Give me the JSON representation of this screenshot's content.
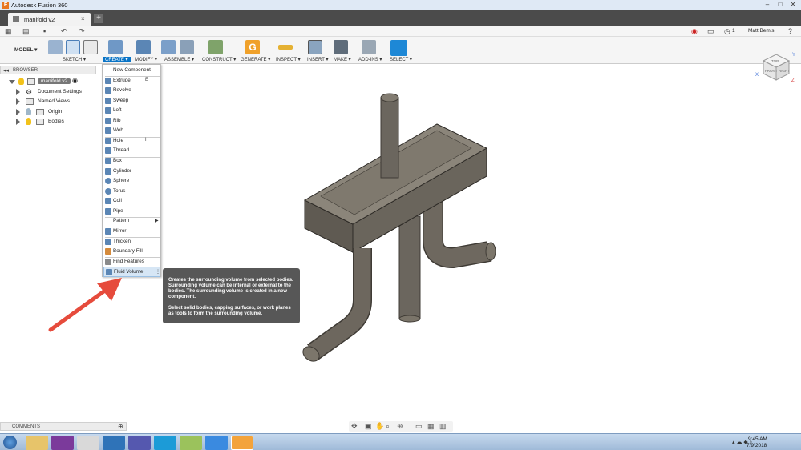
{
  "window": {
    "title": "Autodesk Fusion 360",
    "app_logo": "F"
  },
  "tabs": {
    "doc_title": "manifold v2",
    "close": "×",
    "new_tab": "+"
  },
  "quick_access": {
    "notification_count": "1",
    "user": "Matt Bemis"
  },
  "toolbar": {
    "workspace": "MODEL ▾",
    "groups": [
      "SKETCH ▾",
      "CREATE ▾",
      "MODIFY ▾",
      "ASSEMBLE ▾",
      "CONSTRUCT ▾",
      "GENERATE ▾",
      "INSPECT ▾",
      "INSERT ▾",
      "MAKE ▾",
      "ADD-INS ▾",
      "SELECT ▾"
    ],
    "active_group": "CREATE"
  },
  "browser": {
    "header": "BROWSER",
    "root": "manifold v2",
    "items": [
      "Document Settings",
      "Named Views",
      "Origin",
      "Bodies"
    ]
  },
  "create_menu": {
    "items": [
      {
        "label": "New Component",
        "key": ""
      },
      {
        "label": "Extrude",
        "key": "E"
      },
      {
        "label": "Revolve",
        "key": ""
      },
      {
        "label": "Sweep",
        "key": ""
      },
      {
        "label": "Loft",
        "key": ""
      },
      {
        "label": "Rib",
        "key": ""
      },
      {
        "label": "Web",
        "key": ""
      },
      {
        "label": "Hole",
        "key": "H"
      },
      {
        "label": "Thread",
        "key": ""
      },
      {
        "label": "Box",
        "key": ""
      },
      {
        "label": "Cylinder",
        "key": ""
      },
      {
        "label": "Sphere",
        "key": ""
      },
      {
        "label": "Torus",
        "key": ""
      },
      {
        "label": "Coil",
        "key": ""
      },
      {
        "label": "Pipe",
        "key": ""
      },
      {
        "label": "Pattern",
        "key": ""
      },
      {
        "label": "Mirror",
        "key": ""
      },
      {
        "label": "Thicken",
        "key": ""
      },
      {
        "label": "Boundary Fill",
        "key": ""
      },
      {
        "label": "Find Features",
        "key": ""
      },
      {
        "label": "Fluid Volume",
        "key": ""
      }
    ],
    "highlighted": "Fluid Volume"
  },
  "tooltip": {
    "para1": "Creates the surrounding volume from selected bodies. Surrounding volume can be internal or external to the bodies. The surrounding volume is created in a new component.",
    "para2": "Select solid bodies, capping surfaces, or work planes as tools to form the surrounding volume."
  },
  "viewcube": {
    "top": "TOP",
    "front": "FRONT",
    "right": "RIGHT",
    "axis_x": "X",
    "axis_y": "Y",
    "axis_z": "Z"
  },
  "comments": {
    "label": "COMMENTS"
  },
  "taskbar": {
    "time": "9:45 AM",
    "date": "7/9/2018"
  },
  "colors": {
    "accent": "#0a74c6",
    "arrow": "#e64b3c",
    "model": "#6b665e"
  }
}
